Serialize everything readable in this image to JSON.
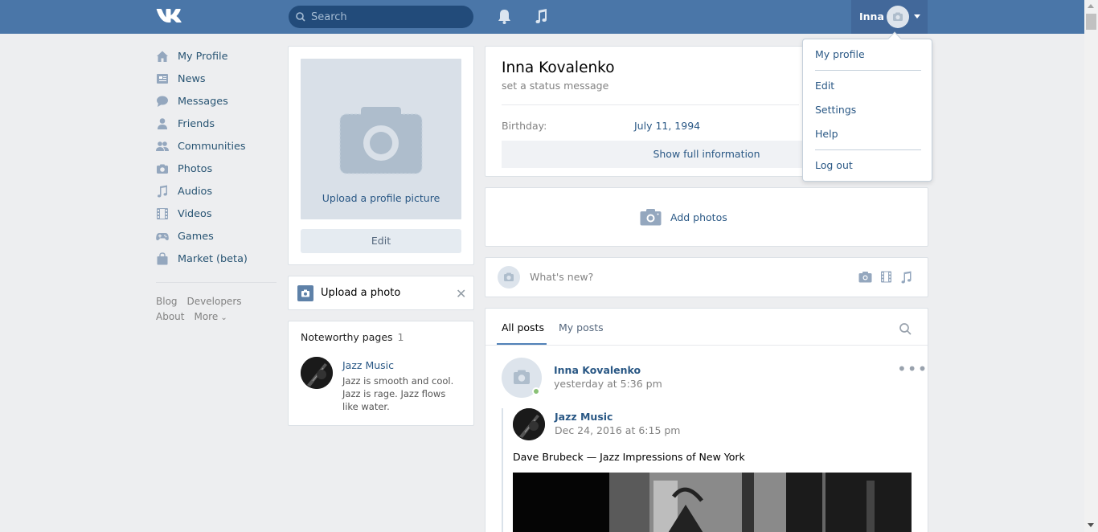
{
  "header": {
    "search_placeholder": "Search",
    "user_name": "Inna"
  },
  "left_menu": {
    "items": [
      {
        "label": "My Profile",
        "icon": "home-icon"
      },
      {
        "label": "News",
        "icon": "news-icon"
      },
      {
        "label": "Messages",
        "icon": "messages-icon"
      },
      {
        "label": "Friends",
        "icon": "friends-icon"
      },
      {
        "label": "Communities",
        "icon": "communities-icon"
      },
      {
        "label": "Photos",
        "icon": "camera-icon"
      },
      {
        "label": "Audios",
        "icon": "music-note-icon"
      },
      {
        "label": "Videos",
        "icon": "film-icon"
      },
      {
        "label": "Games",
        "icon": "gamepad-icon"
      },
      {
        "label": "Market (beta)",
        "icon": "bag-icon"
      }
    ],
    "footer": [
      "Blog",
      "Developers",
      "About",
      "More"
    ]
  },
  "profile_photo": {
    "upload_label": "Upload a profile picture",
    "edit_label": "Edit"
  },
  "upload_photo": {
    "label": "Upload a photo"
  },
  "noteworthy": {
    "title": "Noteworthy pages",
    "count": "1",
    "page_name": "Jazz Music",
    "page_desc": "Jazz is smooth and cool. Jazz is rage. Jazz flows like water."
  },
  "profile": {
    "name": "Inna Kovalenko",
    "status": "set a status message",
    "birthday_label": "Birthday:",
    "birthday_value": "July 11, 1994",
    "show_full": "Show full information"
  },
  "add_photos": {
    "label": "Add photos"
  },
  "new_post": {
    "placeholder": "What's new?"
  },
  "posts": {
    "tab_all": "All posts",
    "tab_mine": "My posts",
    "author": "Inna Kovalenko",
    "time": "yesterday at 5:36 pm",
    "repost_author": "Jazz Music",
    "repost_time": "Dec 24, 2016 at 6:15 pm",
    "text": "Dave Brubeck — Jazz Impressions of New York"
  },
  "dropdown": {
    "my_profile": "My profile",
    "edit": "Edit",
    "settings": "Settings",
    "help": "Help",
    "logout": "Log out"
  },
  "colors": {
    "header_bg": "#4a76a8",
    "link": "#2a5885",
    "page_bg": "#edeef0",
    "online": "#8ac176"
  }
}
